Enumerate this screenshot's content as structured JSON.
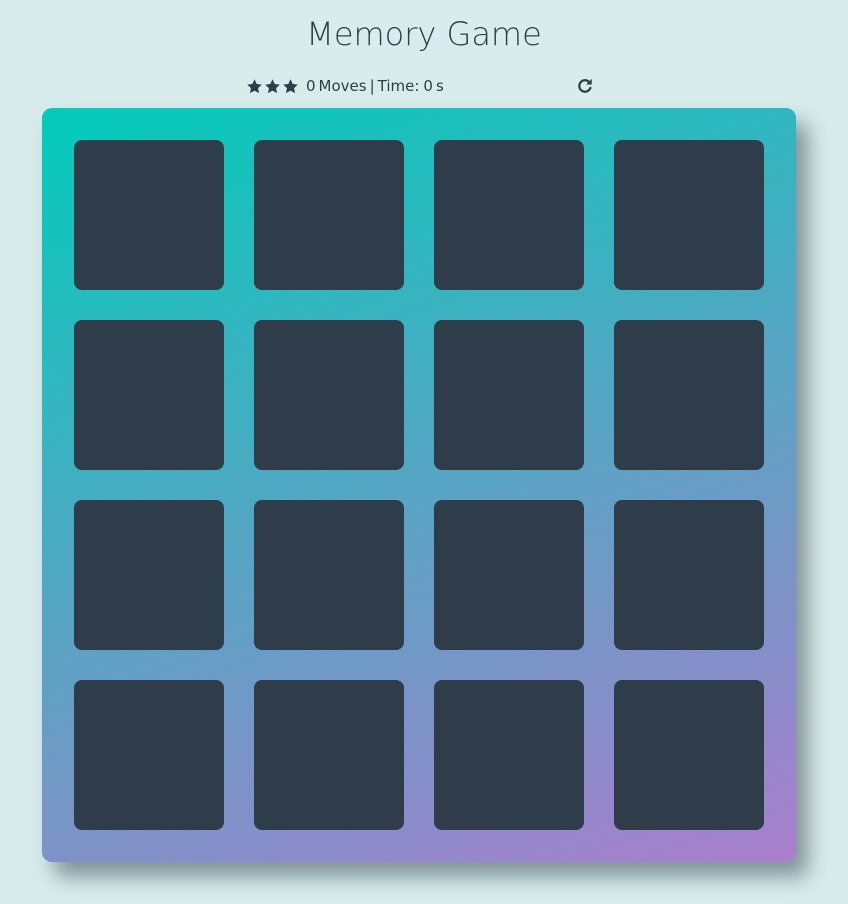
{
  "title": "Memory Game",
  "score_panel": {
    "stars": 3,
    "star_icon": "star-icon",
    "moves": "0",
    "moves_label": "Moves",
    "separator": "|",
    "time_label": "Time:",
    "time_value": "0",
    "time_unit": "s",
    "restart_icon": "repeat-icon"
  },
  "colors": {
    "background": "#d8ecec",
    "text": "#2e3d49",
    "card_back": "#2e3d49",
    "deck_gradient_start": "#02ccba",
    "deck_gradient_end": "#aa7ecd"
  },
  "deck": {
    "rows": 4,
    "columns": 4,
    "cards_face_down": 16
  }
}
